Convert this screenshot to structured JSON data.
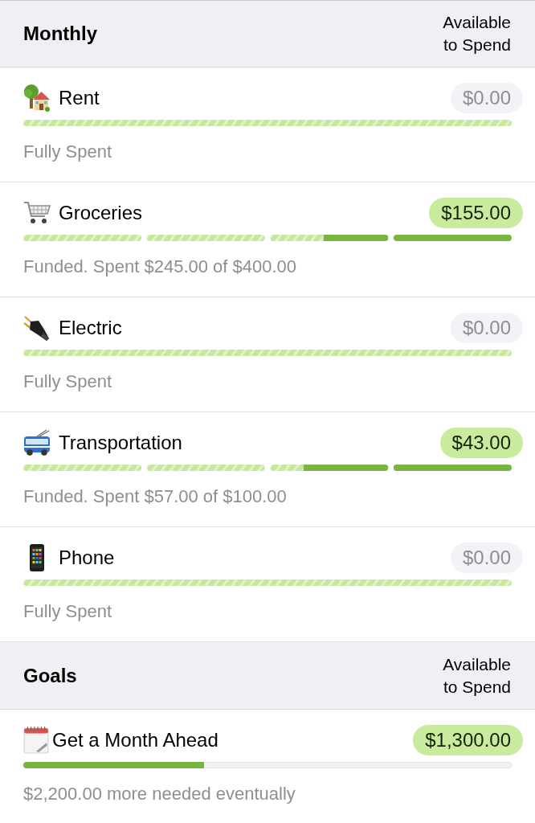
{
  "sections": [
    {
      "title": "Monthly",
      "column_label": "Available to Spend",
      "items": [
        {
          "name": "Rent",
          "amount": {
            "text": "$0.00",
            "highlighted": false
          },
          "bar": {
            "kind": "single",
            "level": 1
          },
          "status": "Fully Spent"
        },
        {
          "name": "Groceries",
          "amount": {
            "text": "$155.00",
            "highlighted": true
          },
          "bar": {
            "kind": "weekly",
            "level": 0.6125
          },
          "status": "Funded. Spent $245.00 of $400.00"
        },
        {
          "name": "Electric",
          "amount": {
            "text": "$0.00",
            "highlighted": false
          },
          "bar": {
            "kind": "single",
            "level": 1
          },
          "status": "Fully Spent"
        },
        {
          "name": "Transportation",
          "amount": {
            "text": "$43.00",
            "highlighted": true
          },
          "bar": {
            "kind": "weekly",
            "level": 0.57
          },
          "status": "Funded. Spent $57.00 of $100.00"
        },
        {
          "name": "Phone",
          "amount": {
            "text": "$0.00",
            "highlighted": false
          },
          "bar": {
            "kind": "single",
            "level": 1
          },
          "status": "Fully Spent"
        }
      ]
    },
    {
      "title": "Goals",
      "column_label": "Available to Spend",
      "items": [
        {
          "name": "Get a Month Ahead",
          "amount": {
            "text": "$1,300.00",
            "highlighted": true
          },
          "bar": {
            "kind": "goal",
            "level": 0.37
          },
          "status": "$2,200.00 more needed eventually"
        }
      ]
    }
  ]
}
